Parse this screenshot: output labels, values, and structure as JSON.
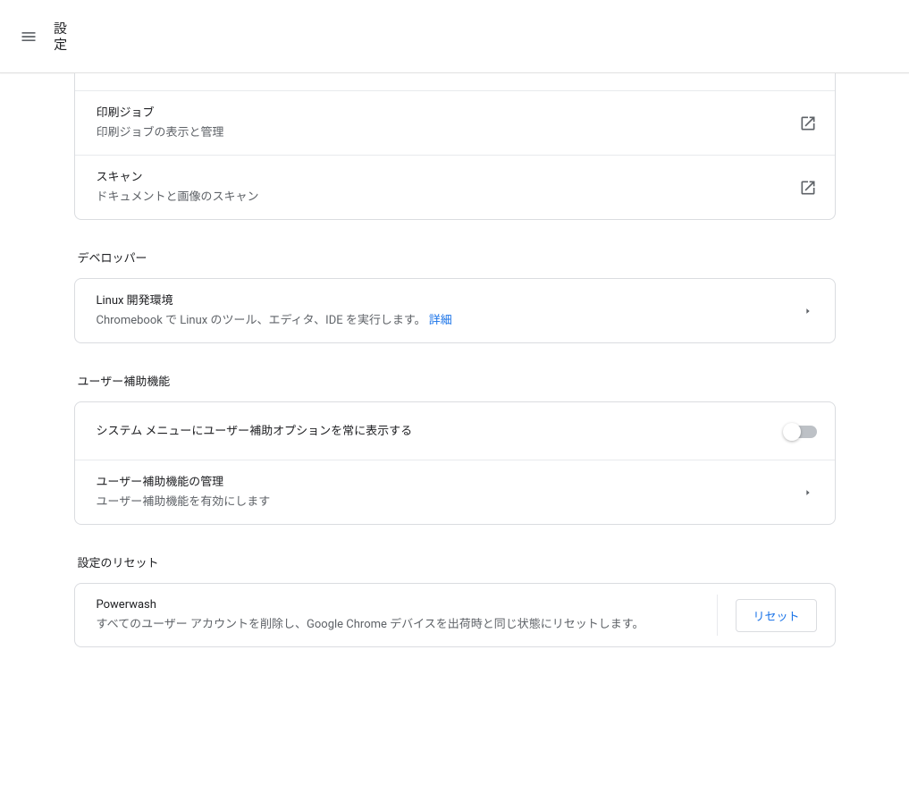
{
  "toolbar": {
    "title": "設定"
  },
  "print_scan": {
    "print_jobs": {
      "title": "印刷ジョブ",
      "sub": "印刷ジョブの表示と管理"
    },
    "scan": {
      "title": "スキャン",
      "sub": "ドキュメントと画像のスキャン"
    }
  },
  "developer": {
    "header": "デベロッパー",
    "linux": {
      "title": "Linux 開発環境",
      "sub": "Chromebook で Linux のツール、エディタ、IDE を実行します。",
      "learn_more": "詳細"
    }
  },
  "accessibility": {
    "header": "ユーザー補助機能",
    "always_show": {
      "title": "システム メニューにユーザー補助オプションを常に表示する"
    },
    "manage": {
      "title": "ユーザー補助機能の管理",
      "sub": "ユーザー補助機能を有効にします"
    }
  },
  "reset": {
    "header": "設定のリセット",
    "powerwash": {
      "title": "Powerwash",
      "sub": "すべてのユーザー アカウントを削除し、Google Chrome デバイスを出荷時と同じ状態にリセットします。",
      "button": "リセット"
    }
  }
}
